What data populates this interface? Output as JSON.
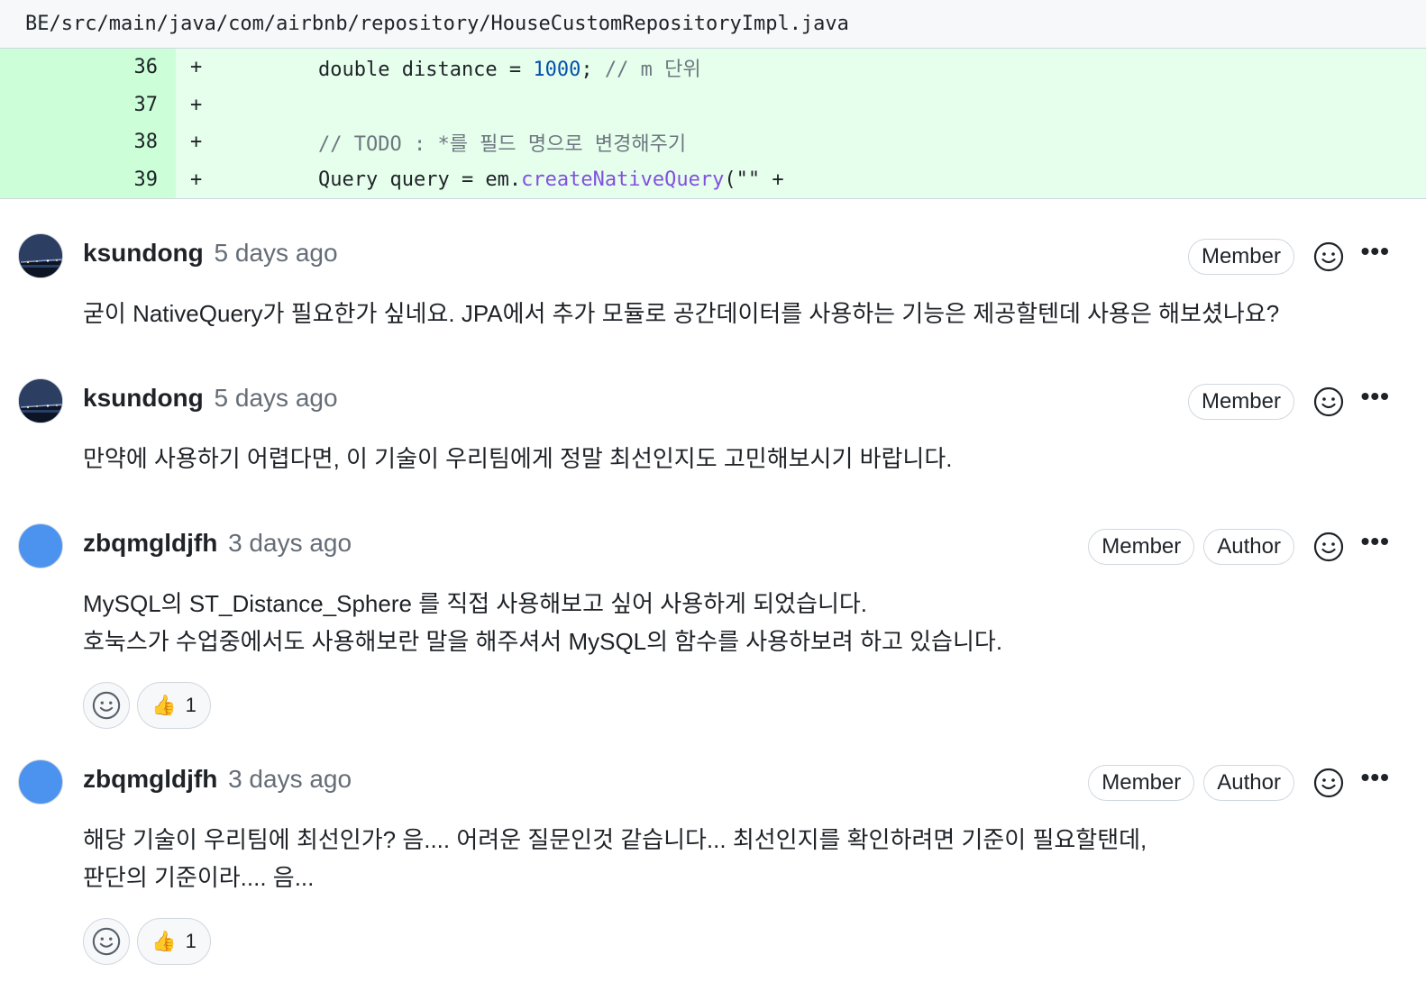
{
  "file": {
    "path": "BE/src/main/java/com/airbnb/repository/HouseCustomRepositoryImpl.java"
  },
  "diff": {
    "lines": [
      {
        "num": "36",
        "sign": "+",
        "a": "double distance = ",
        "b": "1000",
        "c": "; ",
        "d": "// m 단위"
      },
      {
        "num": "37",
        "sign": "+"
      },
      {
        "num": "38",
        "sign": "+",
        "a": "// TODO : *를 필드 명으로 변경해주기"
      },
      {
        "num": "39",
        "sign": "+",
        "a": "Query query = em.",
        "b": "createNativeQuery",
        "c": "(\"\" +"
      }
    ]
  },
  "comments": [
    {
      "author": "ksundong",
      "time": "5 days ago",
      "labels": [
        "Member"
      ],
      "body": [
        "굳이 NativeQuery가 필요한가 싶네요. JPA에서 추가 모듈로 공간데이터를 사용하는 기능은 제공할텐데 사용은 해보셨나요?"
      ]
    },
    {
      "author": "ksundong",
      "time": "5 days ago",
      "labels": [
        "Member"
      ],
      "body": [
        "만약에 사용하기 어렵다면, 이 기술이 우리팀에게 정말 최선인지도 고민해보시기 바랍니다."
      ]
    },
    {
      "author": "zbqmgldjfh",
      "time": "3 days ago",
      "labels": [
        "Member",
        "Author"
      ],
      "body": [
        "MySQL의 ST_Distance_Sphere 를 직접 사용해보고 싶어 사용하게 되었습니다.",
        "호눅스가 수업중에서도 사용해보란 말을 해주셔서 MySQL의 함수를 사용하보려 하고 있습니다."
      ],
      "reaction_count": "1"
    },
    {
      "author": "zbqmgldjfh",
      "time": "3 days ago",
      "labels": [
        "Member",
        "Author"
      ],
      "body": [
        "해당 기술이 우리팀에 최선인가? 음.... 어려운 질문인것 같습니다... 최선인지를 확인하려면 기준이 필요할탠데,",
        "판단의 기준이라.... 음..."
      ],
      "reaction_count": "1"
    }
  ],
  "icons": {
    "smiley": "smiley-icon",
    "kebab": "kebab-horizontal-icon",
    "thumbs_up": "thumbs-up-icon"
  },
  "colors": {
    "diff_bg": "#e6ffec",
    "diff_num_bg": "#ccffd8",
    "number": "#0550ae",
    "comment": "#6e7781",
    "function": "#8250df",
    "avatar_blue": "#4c93f0"
  }
}
